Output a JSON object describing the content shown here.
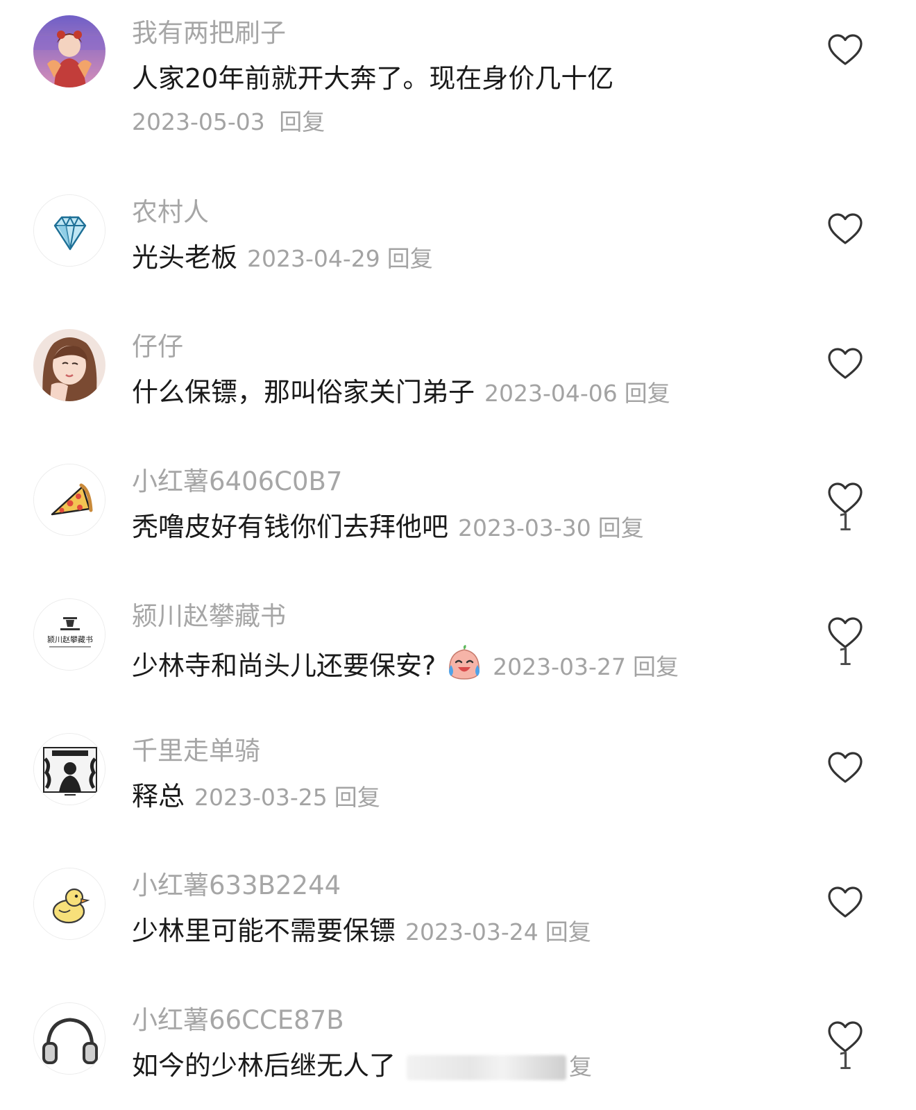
{
  "comments": [
    {
      "avatar": "anime-girl-avatar",
      "username": "我有两把刷子",
      "text": "人家20年前就开大奔了。现在身价几十亿",
      "date": "2023-05-03",
      "reply": "回复",
      "likes": ""
    },
    {
      "avatar": "diamond-avatar",
      "username": "农村人",
      "text": "光头老板",
      "date": "2023-04-29",
      "reply": "回复",
      "likes": ""
    },
    {
      "avatar": "woman-photo-avatar",
      "username": "仔仔",
      "text": "什么保镖，那叫俗家关门弟子",
      "date": "2023-04-06",
      "reply": "回复",
      "likes": ""
    },
    {
      "avatar": "pizza-avatar",
      "username": "小红薯6406C0B7",
      "text": "秃噜皮好有钱你们去拜他吧",
      "date": "2023-03-30",
      "reply": "回复",
      "likes": "1"
    },
    {
      "avatar": "book-logo-avatar",
      "avatar_text": "颍川赵攀藏书",
      "username": "颍川赵攀藏书",
      "text": "少林寺和尚头儿还要保安?",
      "emoji": "crying-laughing-emoji",
      "date": "2023-03-27",
      "reply": "回复",
      "likes": "1"
    },
    {
      "avatar": "emblem-avatar",
      "username": "千里走单骑",
      "text": "释总",
      "date": "2023-03-25",
      "reply": "回复",
      "likes": ""
    },
    {
      "avatar": "duck-avatar",
      "username": "小红薯633B2244",
      "text": "少林里可能不需要保镖",
      "date": "2023-03-24",
      "reply": "回复",
      "likes": ""
    },
    {
      "avatar": "headphones-avatar",
      "username": "小红薯66CCE87B",
      "text": "如今的少林后继无人了",
      "date": "",
      "reply": "复",
      "likes": "1"
    }
  ],
  "colors": {
    "username": "#a6a6a6",
    "text": "#1a1a1a",
    "meta": "#a3a3a3",
    "icon": "#333333"
  }
}
